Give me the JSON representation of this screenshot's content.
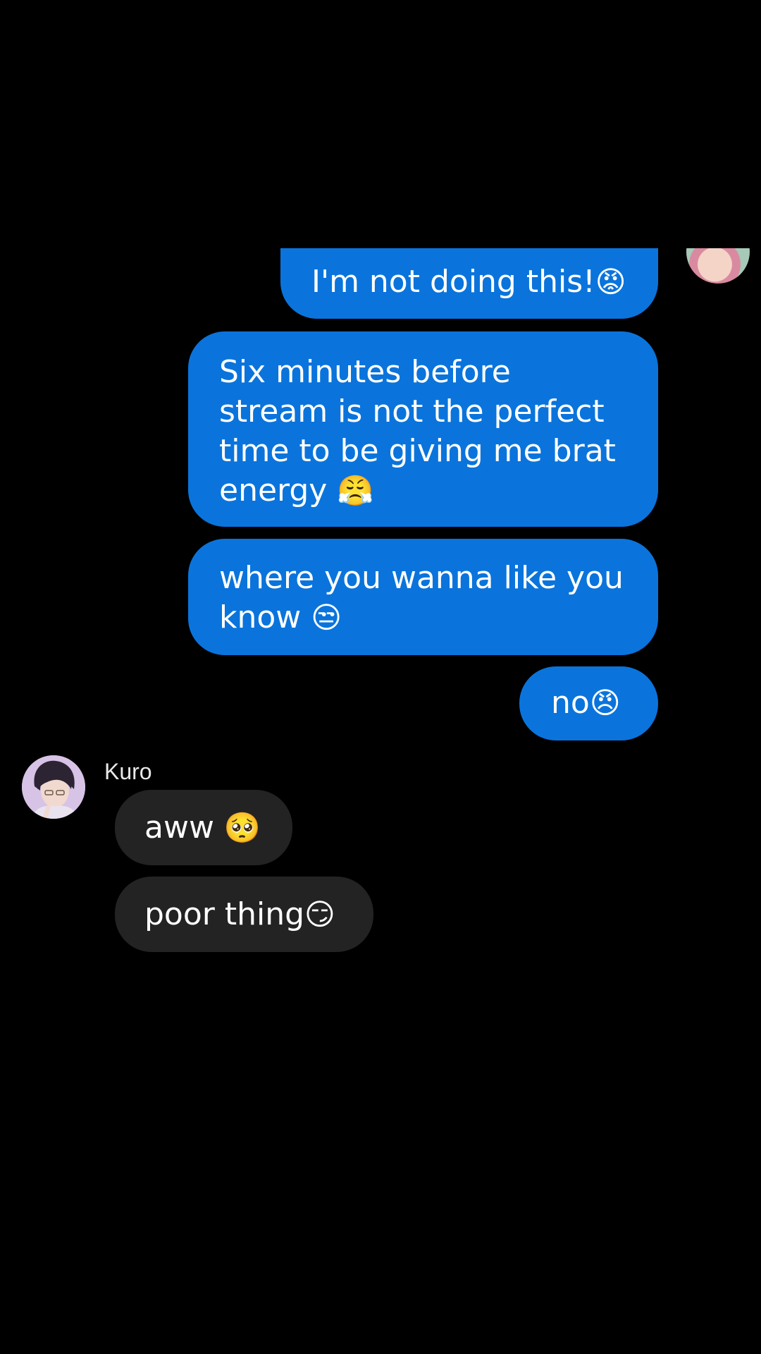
{
  "conversation": {
    "contact_name": "Kuro",
    "messages": [
      {
        "direction": "outgoing",
        "text": "I'm not doing this!",
        "emoji": "😡"
      },
      {
        "direction": "outgoing",
        "text": "Six minutes before stream is not the perfect time to be giving me brat energy ",
        "emoji": "😤"
      },
      {
        "direction": "outgoing",
        "text": "where you wanna like you know ",
        "emoji": "😒"
      },
      {
        "direction": "outgoing",
        "text": "no",
        "emoji": "😠"
      },
      {
        "direction": "incoming",
        "sender": "Kuro",
        "text": "aww ",
        "emoji": "🥺"
      },
      {
        "direction": "incoming",
        "sender": "Kuro",
        "text": "poor thing",
        "emoji": "😏"
      }
    ]
  },
  "theme": {
    "background": "#000000",
    "outgoing_bubble": "#0a74dc",
    "incoming_bubble": "#232323",
    "text": "#ffffff"
  },
  "icons": {
    "self_avatar": "self-avatar",
    "contact_avatar": "contact-avatar"
  }
}
